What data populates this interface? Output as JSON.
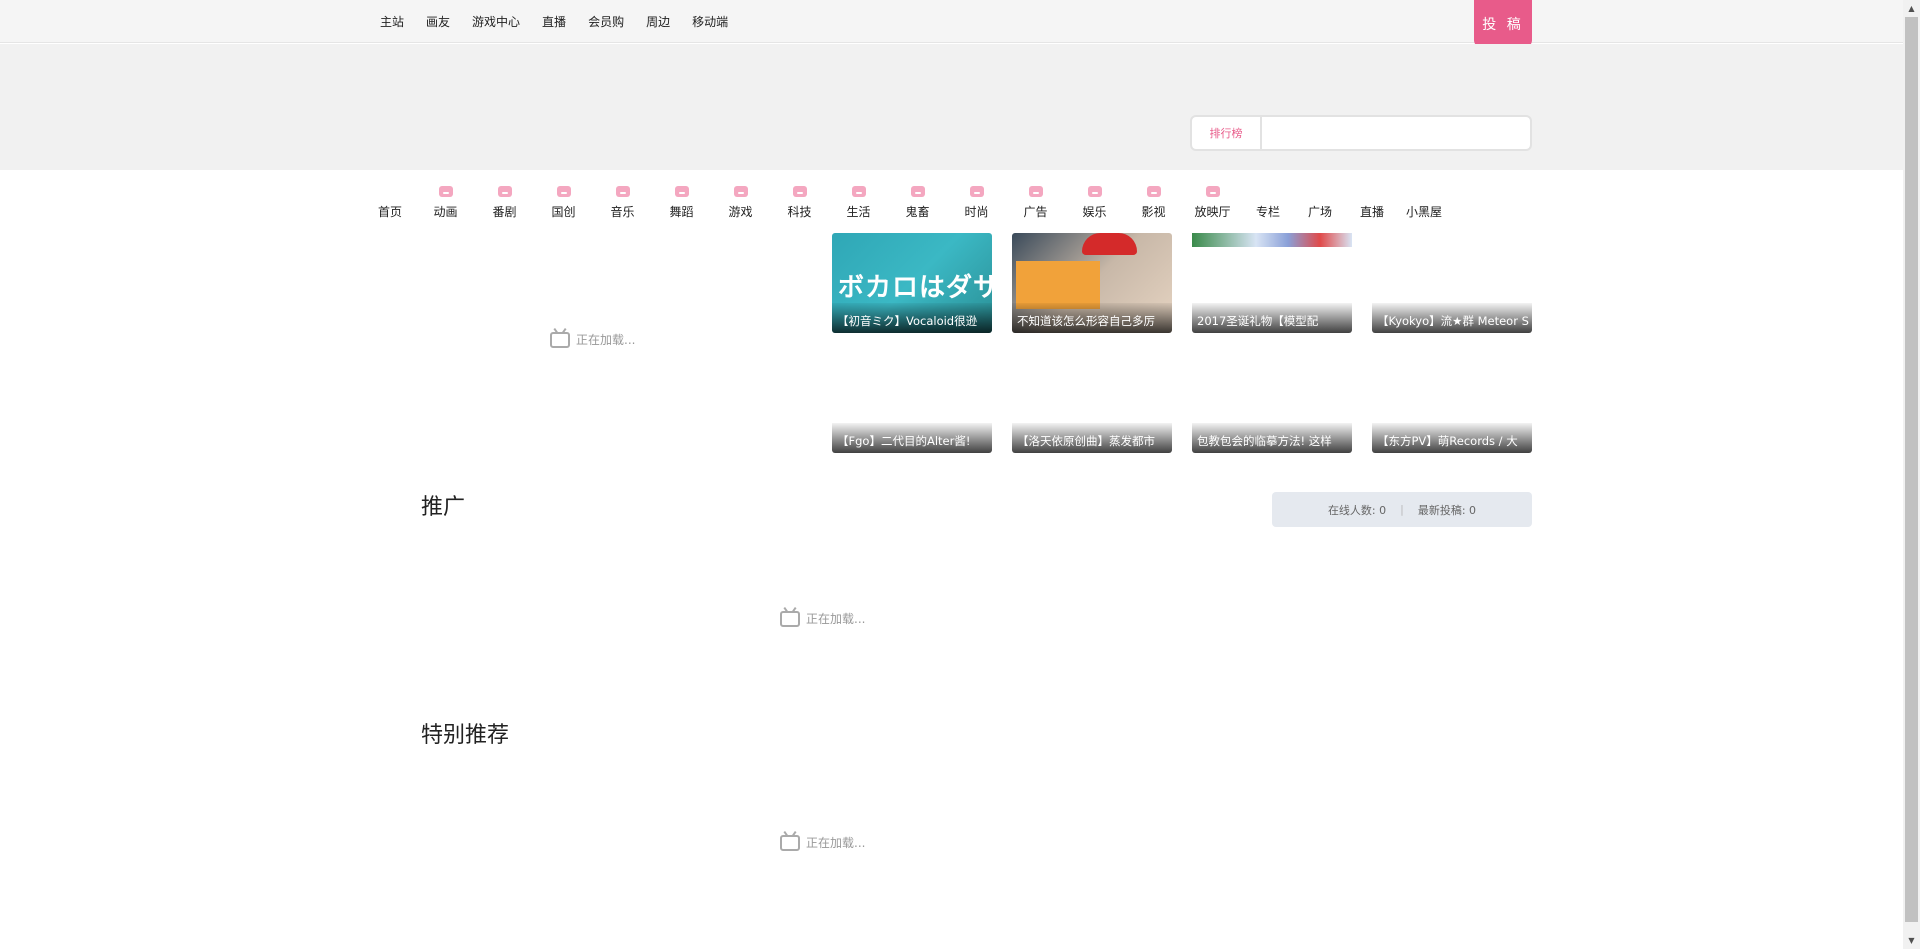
{
  "topnav": {
    "items": [
      "主站",
      "画友",
      "游戏中心",
      "直播",
      "会员购",
      "周边",
      "移动端"
    ],
    "upload_label": "投 稿"
  },
  "search": {
    "rank_label": "排行榜",
    "placeholder": ""
  },
  "categories": [
    {
      "label": "首页",
      "emoji": false
    },
    {
      "label": "动画",
      "emoji": true
    },
    {
      "label": "番剧",
      "emoji": true
    },
    {
      "label": "国创",
      "emoji": true
    },
    {
      "label": "音乐",
      "emoji": true
    },
    {
      "label": "舞蹈",
      "emoji": true
    },
    {
      "label": "游戏",
      "emoji": true
    },
    {
      "label": "科技",
      "emoji": true
    },
    {
      "label": "生活",
      "emoji": true
    },
    {
      "label": "鬼畜",
      "emoji": true
    },
    {
      "label": "时尚",
      "emoji": true
    },
    {
      "label": "广告",
      "emoji": true
    },
    {
      "label": "娱乐",
      "emoji": true
    },
    {
      "label": "影视",
      "emoji": true
    },
    {
      "label": "放映厅",
      "emoji": true
    },
    {
      "label": "专栏",
      "emoji": false
    },
    {
      "label": "广场",
      "emoji": false
    },
    {
      "label": "直播",
      "emoji": false
    },
    {
      "label": "小黑屋",
      "emoji": false
    }
  ],
  "loading_text": "正在加载...",
  "videos": [
    {
      "title": "【初音ミク】Vocaloid很逊",
      "thumb_text": "ボカロはダサい"
    },
    {
      "title": "不知道该怎么形容自己多厉"
    },
    {
      "title": "2017圣诞礼物【模型配"
    },
    {
      "title": "【Kyokyo】流★群 Meteor S"
    },
    {
      "title": "【Fgo】二代目的Alter酱!"
    },
    {
      "title": "【洛天依原创曲】蒸发都市"
    },
    {
      "title": "包教包会的临摹方法! 这样"
    },
    {
      "title": "【东方PV】萌Records / 大"
    }
  ],
  "sections": {
    "promo_title": "推广",
    "special_title": "特别推荐"
  },
  "online": {
    "online_label": "在线人数: 0",
    "latest_label": "最新投稿: 0"
  }
}
